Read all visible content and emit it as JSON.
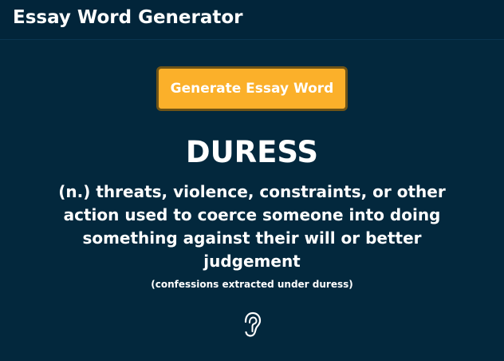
{
  "header": {
    "title": "Essay Word Generator"
  },
  "generator": {
    "button_label": "Generate Essay Word",
    "word": "DURESS",
    "definition": "(n.) threats, violence, constraints, or other action used to coerce someone into doing something against their will or better judgement",
    "example": "(confessions extracted under duress)"
  },
  "pronounce": {
    "icon": "ear-icon"
  },
  "colors": {
    "background": "#03283d",
    "button": "#fbb02a",
    "button_border": "#6f5416",
    "text": "#ffffff"
  }
}
